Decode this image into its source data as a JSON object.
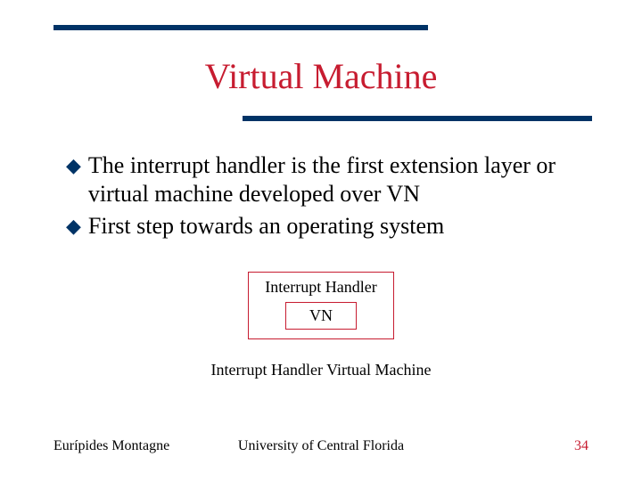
{
  "title": "Virtual Machine",
  "bullets": [
    "The interrupt handler is the first extension layer or virtual machine developed over VN",
    "First step towards an operating system"
  ],
  "diagram": {
    "outer_label": "Interrupt Handler",
    "inner_label": "VN",
    "caption": "Interrupt Handler Virtual Machine"
  },
  "footer": {
    "left": "Eurípides Montagne",
    "center": "University of Central Florida",
    "right": "34"
  }
}
